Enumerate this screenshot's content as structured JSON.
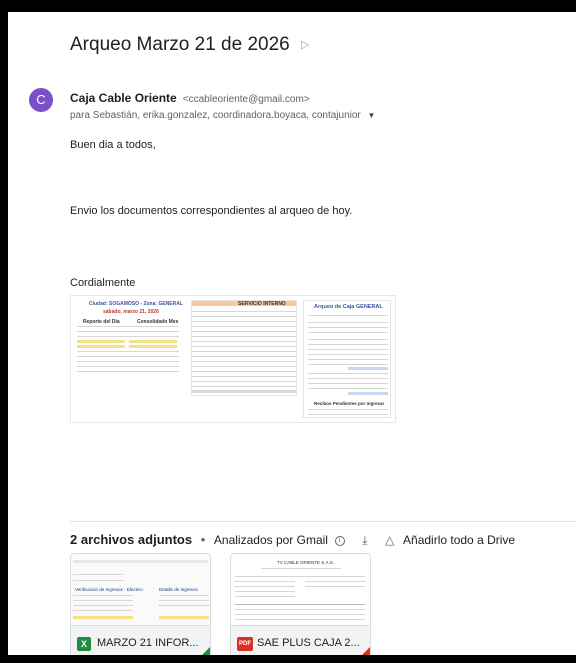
{
  "email": {
    "subject": "Arqueo Marzo 21 de 2026",
    "label_icon": "label-arrow-icon",
    "sender_initial": "C",
    "sender_name": "Caja Cable Oriente",
    "sender_email": "<ccableoriente@gmail.com>",
    "recipients": "para Sebastián, erika.gonzalez, coordinadora.boyaca, contajunior",
    "greeting": "Buen dia a todos,",
    "body": "Envio los documentos correspondientes al arqueo de hoy.",
    "closing": "Cordialmente"
  },
  "inline_image": {
    "sheet1_title": "Ciudad: SOGAMOSO - Zona: GENERAL",
    "sheet1_date": "sábado, marzo 21, 2026",
    "sheet1_left_header": "Reporte del Día",
    "sheet1_right_header": "Consolidado Mes",
    "sheet2_header": "SERVICIO INTERNO",
    "sheet3_title": "Arqueo de Caja GENERAL",
    "sheet3_footer": "Recibos Pendientes por Ingresar"
  },
  "attachments": {
    "count_label": "2 archivos adjuntos",
    "scan_label": "Analizados por Gmail",
    "drive_label": "Añadirlo todo a Drive",
    "files": [
      {
        "type_icon": "X",
        "name": "MARZO 21 INFOR...",
        "color": "#1e8e3e",
        "preview_label_1": "Verificación de Ingresos - Efectivo",
        "preview_label_2": "Detalle de Ingresos"
      },
      {
        "type_icon": "PDF",
        "name": "SAE PLUS CAJA 2...",
        "color": "#d93025",
        "preview_label_1": "TV CABLE ORIENTE S.A.S."
      }
    ]
  }
}
